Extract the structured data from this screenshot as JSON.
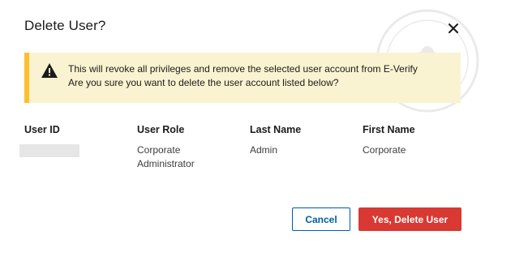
{
  "dialog": {
    "title": "Delete User?",
    "close_icon": "close-icon"
  },
  "alert": {
    "icon": "warning-icon",
    "line1": "This will revoke all privileges and remove the selected user account from E-Verify",
    "line2": "Are you sure you want to delete the user account listed below?",
    "accent_color": "#ffbe2e",
    "background_color": "#faf3d1"
  },
  "table": {
    "headers": [
      "User ID",
      "User Role",
      "Last Name",
      "First Name"
    ],
    "row": {
      "user_id": "",
      "user_role_line1": "Corporate",
      "user_role_line2": "Administrator",
      "last_name": "Admin",
      "first_name": "Corporate"
    }
  },
  "buttons": {
    "cancel_label": "Cancel",
    "delete_label": "Yes, Delete User",
    "cancel_color": "#005ea2",
    "delete_color": "#d83933"
  }
}
